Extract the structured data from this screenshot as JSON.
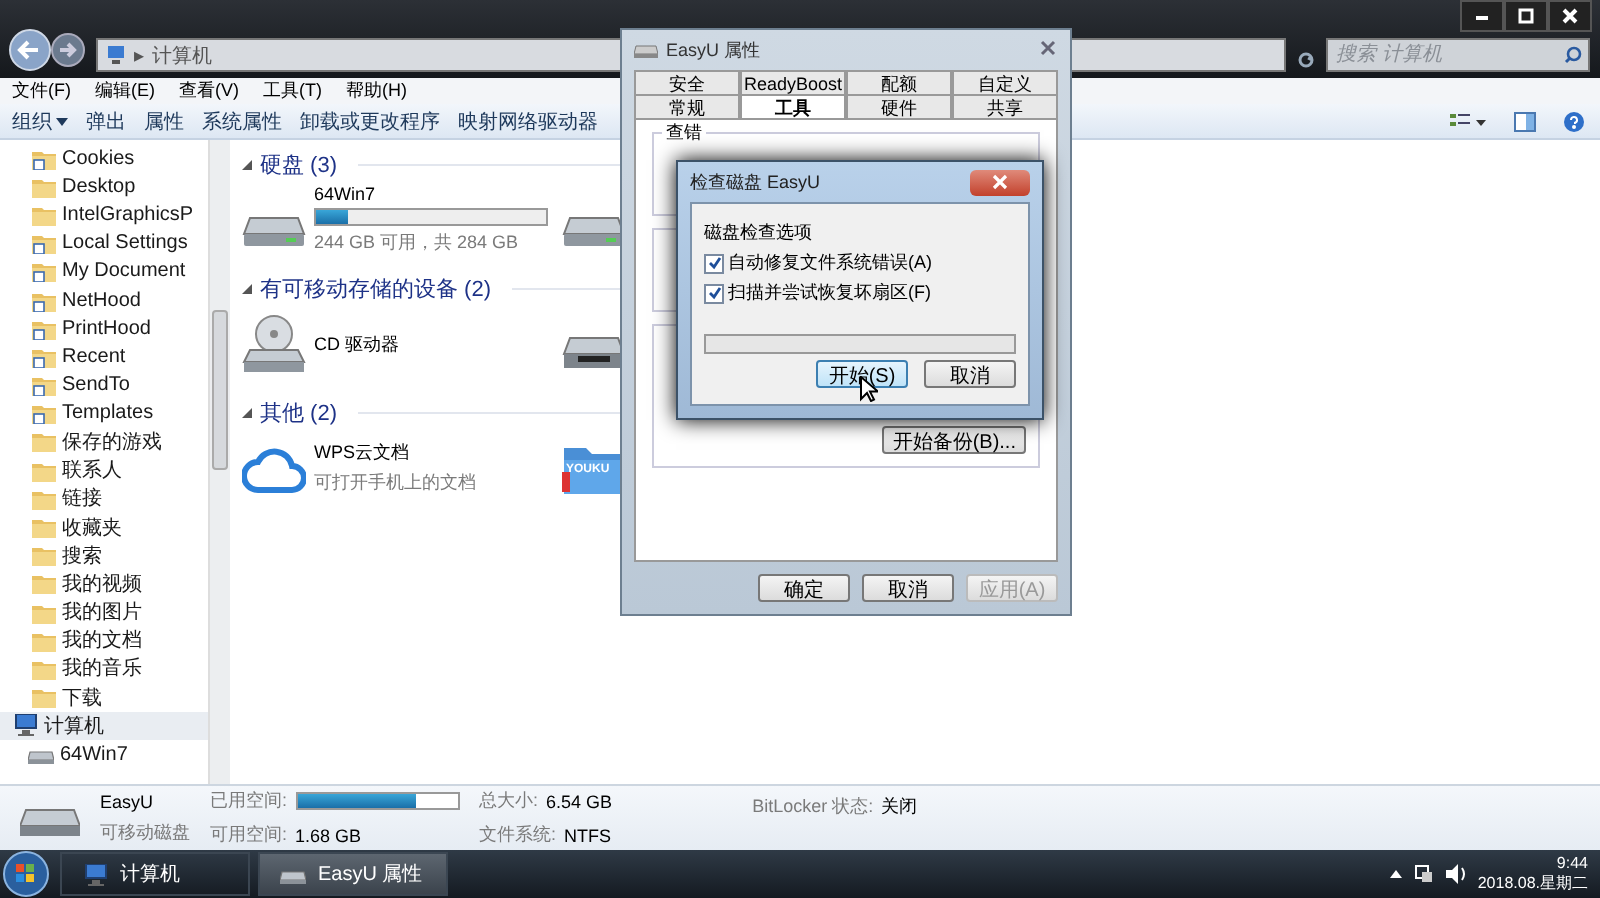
{
  "explorer": {
    "address": "计算机",
    "address_separator": "▸",
    "search": {
      "placeholder": "搜索 计算机"
    },
    "menu": [
      "文件(F)",
      "编辑(E)",
      "查看(V)",
      "工具(T)",
      "帮助(H)"
    ],
    "toolbar": [
      {
        "label": "组织",
        "kind": "menu"
      },
      {
        "label": "弹出",
        "kind": "plain"
      },
      {
        "label": "属性",
        "kind": "plain"
      },
      {
        "label": "系统属性",
        "kind": "plain"
      },
      {
        "label": "卸载或更改程序",
        "kind": "plain"
      },
      {
        "label": "映射网络驱动器",
        "kind": "plain"
      }
    ],
    "sidebar": {
      "items": [
        {
          "label": "Cookies",
          "kind": "link",
          "selected": false
        },
        {
          "label": "Desktop",
          "kind": "folder",
          "selected": false
        },
        {
          "label": "IntelGraphicsP",
          "kind": "folder",
          "selected": false
        },
        {
          "label": "Local Settings",
          "kind": "link",
          "selected": false
        },
        {
          "label": "My Document",
          "kind": "link",
          "selected": false
        },
        {
          "label": "NetHood",
          "kind": "link",
          "selected": false
        },
        {
          "label": "PrintHood",
          "kind": "link",
          "selected": false
        },
        {
          "label": "Recent",
          "kind": "link",
          "selected": false
        },
        {
          "label": "SendTo",
          "kind": "link",
          "selected": false
        },
        {
          "label": "Templates",
          "kind": "link",
          "selected": false
        },
        {
          "label": "保存的游戏",
          "kind": "folder",
          "selected": false
        },
        {
          "label": "联系人",
          "kind": "folder",
          "selected": false
        },
        {
          "label": "链接",
          "kind": "folder",
          "selected": false
        },
        {
          "label": "收藏夹",
          "kind": "folder",
          "selected": false
        },
        {
          "label": "搜索",
          "kind": "folder",
          "selected": false
        },
        {
          "label": "我的视频",
          "kind": "folder",
          "selected": false
        },
        {
          "label": "我的图片",
          "kind": "folder",
          "selected": false
        },
        {
          "label": "我的文档",
          "kind": "folder",
          "selected": false
        },
        {
          "label": "我的音乐",
          "kind": "folder",
          "selected": false
        },
        {
          "label": "下载",
          "kind": "folder",
          "selected": false
        },
        {
          "label": "计算机",
          "kind": "computer",
          "selected": true,
          "children": [
            {
              "label": "64Win7",
              "kind": "drive",
              "selected": false
            }
          ]
        }
      ]
    },
    "groups": [
      {
        "title": "硬盘 (3)",
        "items": [
          {
            "kind": "drive",
            "name": "64Win7",
            "level": 0.14,
            "info": "244 GB 可用，共 284 GB"
          },
          {
            "kind": "drive"
          }
        ]
      },
      {
        "title": "有可移动存储的设备 (2)",
        "items": [
          {
            "kind": "cd",
            "name": "CD 驱动器"
          },
          {
            "kind": "usb"
          }
        ]
      },
      {
        "title": "其他 (2)",
        "items": [
          {
            "kind": "cloud",
            "name": "WPS云文档",
            "info": "可打开手机上的文档"
          },
          {
            "kind": "folder",
            "badge": "YOUKU"
          }
        ]
      }
    ],
    "details": {
      "name": "EasyU",
      "type": "可移动磁盘",
      "used": {
        "label": "已用空间:",
        "level": 0.74
      },
      "free_label": "可用空间:",
      "free": "1.68 GB",
      "total_label": "总大小:",
      "total": "6.54 GB",
      "fs_label": "文件系统:",
      "fs": "NTFS",
      "bitlocker_label": "BitLocker 状态:",
      "bitlocker": "关闭"
    }
  },
  "properties": {
    "title": "EasyU 属性",
    "tab_rows": [
      [
        {
          "label": "安全",
          "selected": false
        },
        {
          "label": "ReadyBoost",
          "selected": false
        },
        {
          "label": "配额",
          "selected": false
        },
        {
          "label": "自定义",
          "selected": false
        }
      ],
      [
        {
          "label": "常规",
          "selected": false
        },
        {
          "label": "工具",
          "selected": true
        },
        {
          "label": "硬件",
          "selected": false
        },
        {
          "label": "共享",
          "selected": false
        }
      ]
    ],
    "group_title": "查错",
    "backup_button": "开始备份(B)...",
    "buttons": [
      {
        "label": "确定",
        "disabled": false
      },
      {
        "label": "取消",
        "disabled": false
      },
      {
        "label": "应用(A)",
        "disabled": true
      }
    ]
  },
  "check_disk": {
    "title": "检查磁盘 EasyU",
    "options_title": "磁盘检查选项",
    "options": [
      {
        "label": "自动修复文件系统错误(A)",
        "checked": true
      },
      {
        "label": "扫描并尝试恢复坏扇区(F)",
        "checked": true
      }
    ],
    "progress": {
      "level": 0
    },
    "buttons": [
      {
        "label": "开始(S)",
        "focused": true
      },
      {
        "label": "取消",
        "focused": false
      }
    ]
  },
  "taskbar": {
    "tasks": [
      {
        "label": "计算机",
        "kind": "computer",
        "selected": false
      },
      {
        "label": "EasyU 属性",
        "kind": "drive",
        "selected": true
      }
    ],
    "time": "9:44",
    "date": "2018.08.星期二"
  }
}
